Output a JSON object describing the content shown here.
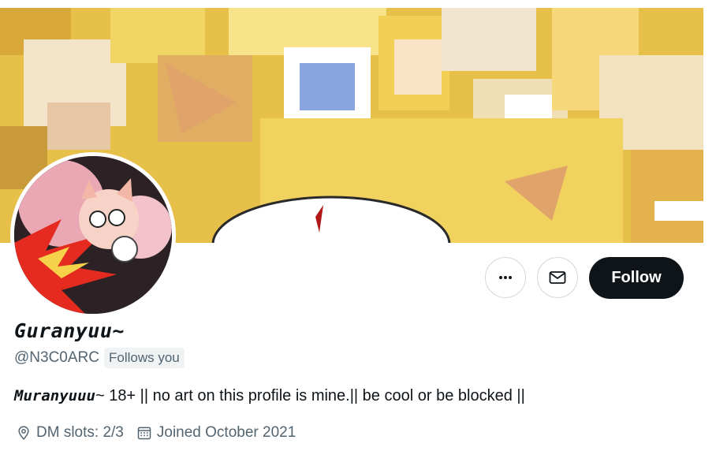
{
  "profile": {
    "display_name": "Guranyuu~",
    "handle": "@N3C0ARC",
    "follows_you": "Follows you"
  },
  "bio": {
    "name": "Muranyuuu",
    "text": "~ 18+ || no art on this profile is mine.|| be cool or be blocked ||"
  },
  "meta": {
    "location": "DM slots: 2/3",
    "joined": "Joined October 2021"
  },
  "actions": {
    "more_icon": "more-horizontal-icon",
    "message_icon": "envelope-icon",
    "follow_label": "Follow"
  },
  "colors": {
    "follow_bg": "#0f1419",
    "secondary_text": "#536471",
    "border": "#cfd9de",
    "badge_bg": "#eff3f4"
  }
}
